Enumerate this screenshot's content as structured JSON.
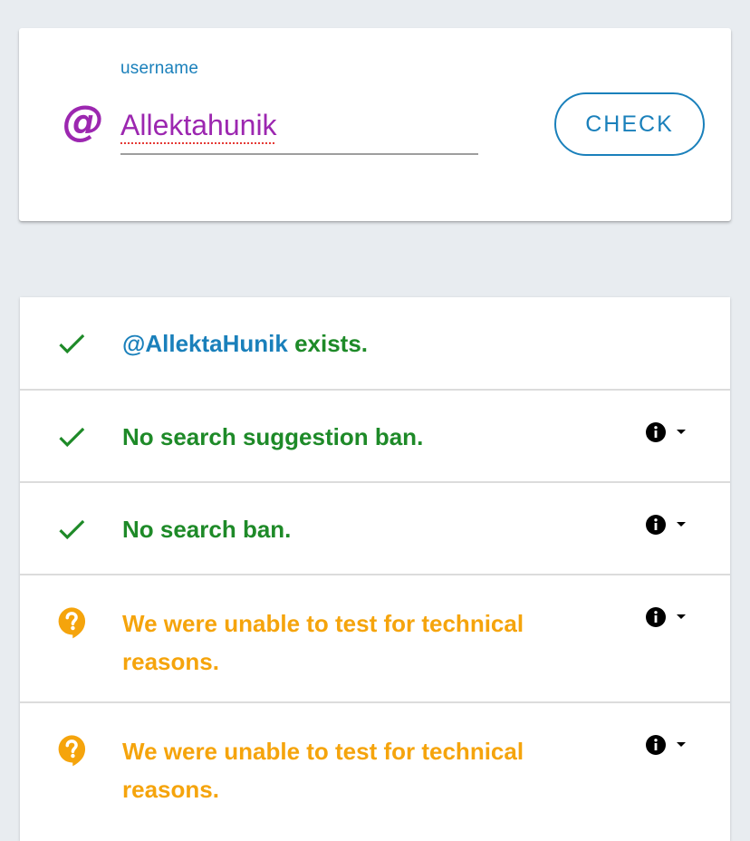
{
  "search": {
    "field_label": "username",
    "username_value": "Allektahunik",
    "check_button_label": "CHECK",
    "prefix_icon": "at-sign-icon"
  },
  "results": [
    {
      "status": "ok",
      "icon": "check-icon",
      "handle": "@AllektaHunik",
      "message": " exists.",
      "has_info": false
    },
    {
      "status": "ok",
      "icon": "check-icon",
      "message": "No search suggestion ban.",
      "has_info": true
    },
    {
      "status": "ok",
      "icon": "check-icon",
      "message": "No search ban.",
      "has_info": true
    },
    {
      "status": "unknown",
      "icon": "question-bubble-icon",
      "message": "We were unable to test for technical reasons.",
      "has_info": true
    },
    {
      "status": "unknown",
      "icon": "question-bubble-icon",
      "message": "We were unable to test for technical reasons.",
      "has_info": true
    }
  ],
  "colors": {
    "background": "#e8ecf0",
    "accent_blue": "#1a80bb",
    "username_purple": "#9c27b0",
    "ok_green": "#1e8a28",
    "warning_orange": "#f5a40c"
  }
}
